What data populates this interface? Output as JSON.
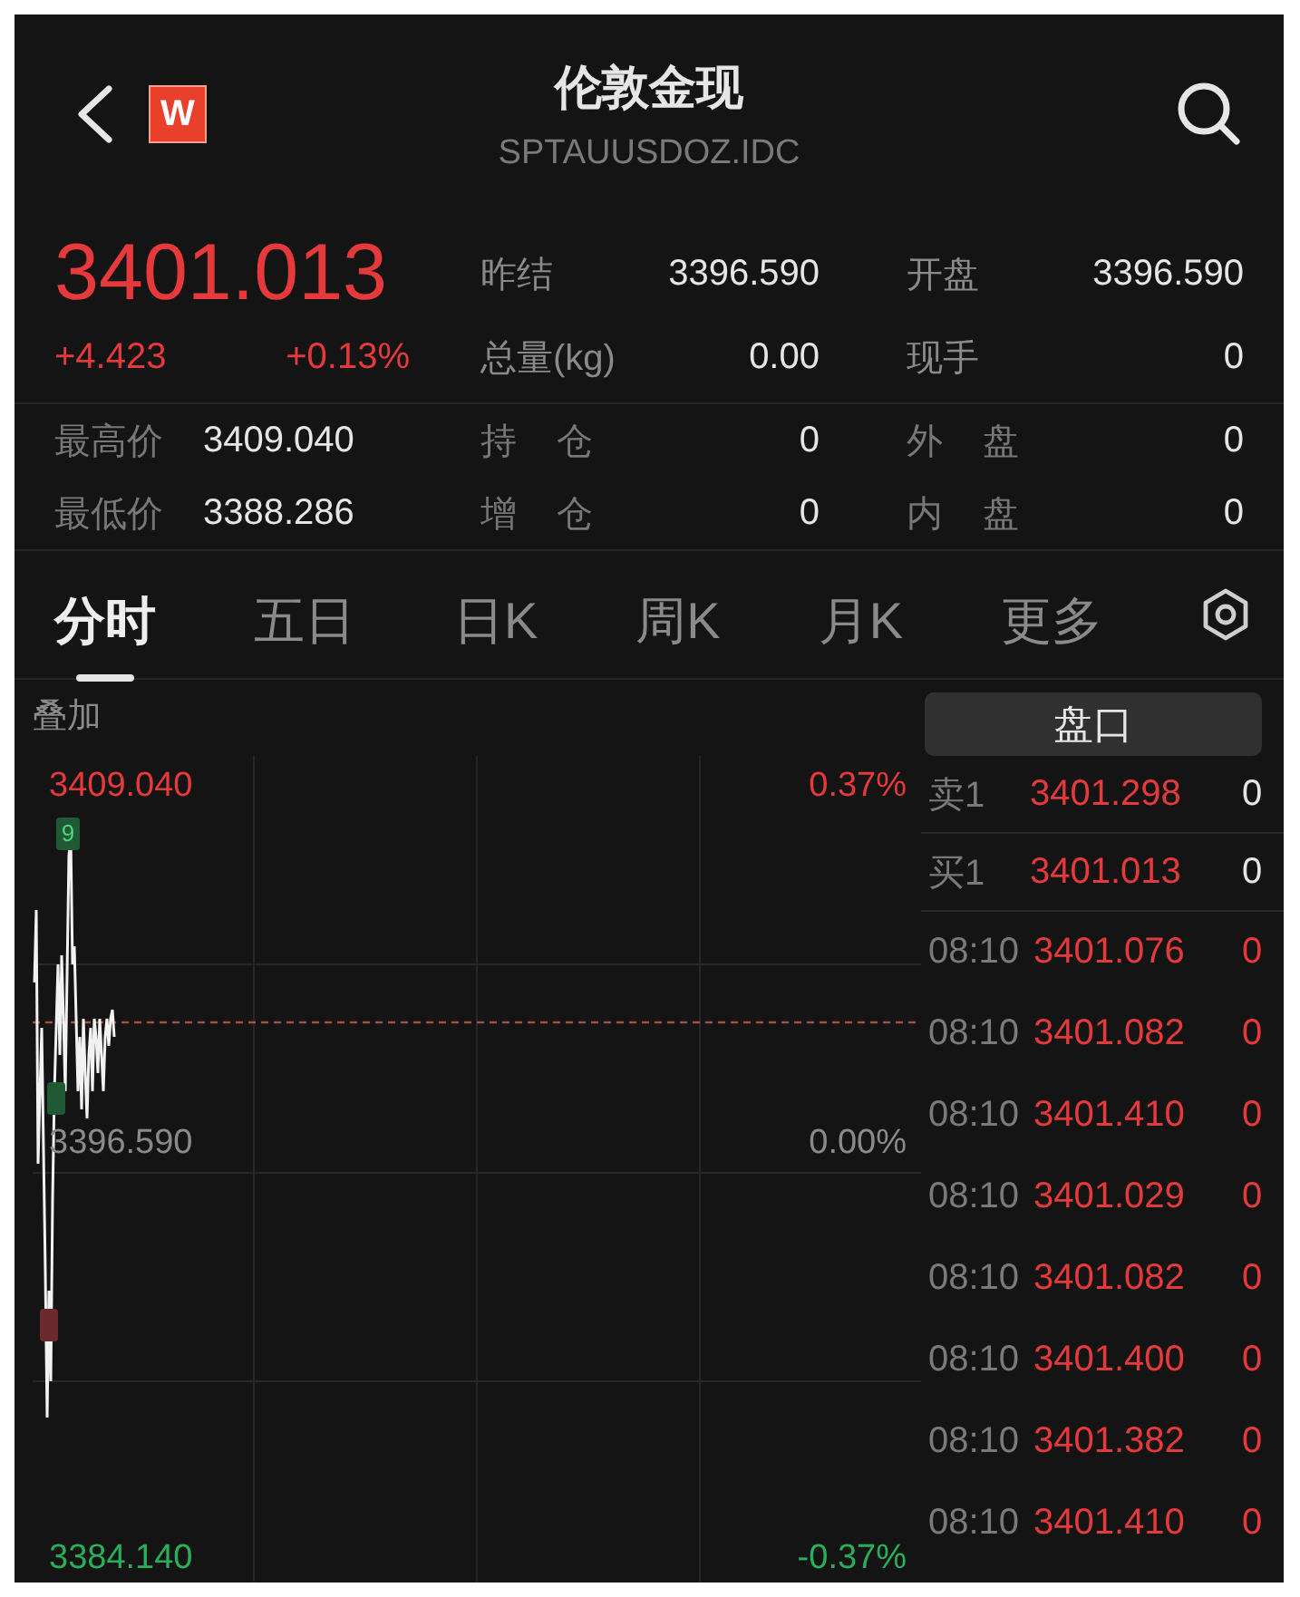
{
  "header": {
    "logo_text": "W",
    "title": "伦敦金现",
    "subtitle": "SPTAUUSDOZ.IDC"
  },
  "quote": {
    "price": "3401.013",
    "change": "+4.423",
    "change_pct": "+0.13%"
  },
  "stats_top": [
    {
      "label": "昨结",
      "value": "3396.590"
    },
    {
      "label": "开盘",
      "value": "3396.590"
    },
    {
      "label": "总量(kg)",
      "value": "0.00"
    },
    {
      "label": "现手",
      "value": "0"
    }
  ],
  "stats_bottom": [
    {
      "label": "最高价",
      "value": "3409.040"
    },
    {
      "label": "持 仓",
      "value": "0"
    },
    {
      "label": "外 盘",
      "value": "0"
    },
    {
      "label": "最低价",
      "value": "3388.286"
    },
    {
      "label": "增 仓",
      "value": "0"
    },
    {
      "label": "内 盘",
      "value": "0"
    }
  ],
  "tabs": [
    {
      "label": "分时",
      "selected": true
    },
    {
      "label": "五日",
      "selected": false
    },
    {
      "label": "日K",
      "selected": false
    },
    {
      "label": "周K",
      "selected": false
    },
    {
      "label": "月K",
      "selected": false
    },
    {
      "label": "更多",
      "selected": false
    }
  ],
  "overlay_label": "叠加",
  "chart": {
    "labels": [
      {
        "text": "3409.040",
        "color": "#e5393b"
      },
      {
        "text": "0.37%",
        "color": "#e5393b"
      },
      {
        "text": "3396.590",
        "color": "#8a8a8a"
      },
      {
        "text": "0.00%",
        "color": "#8a8a8a"
      },
      {
        "text": "3384.140",
        "color": "#27b05a"
      },
      {
        "text": "-0.37%",
        "color": "#27b05a"
      }
    ],
    "tag": "9"
  },
  "panel_button": "盘口",
  "book": [
    {
      "label": "卖1",
      "price": "3401.298",
      "volume": "0"
    },
    {
      "label": "买1",
      "price": "3401.013",
      "volume": "0"
    }
  ],
  "trades": [
    {
      "time": "08:10",
      "price": "3401.076",
      "volume": "0"
    },
    {
      "time": "08:10",
      "price": "3401.082",
      "volume": "0"
    },
    {
      "time": "08:10",
      "price": "3401.410",
      "volume": "0"
    },
    {
      "time": "08:10",
      "price": "3401.029",
      "volume": "0"
    },
    {
      "time": "08:10",
      "price": "3401.082",
      "volume": "0"
    },
    {
      "time": "08:10",
      "price": "3401.400",
      "volume": "0"
    },
    {
      "time": "08:10",
      "price": "3401.382",
      "volume": "0"
    },
    {
      "time": "08:10",
      "price": "3401.410",
      "volume": "0"
    }
  ]
}
